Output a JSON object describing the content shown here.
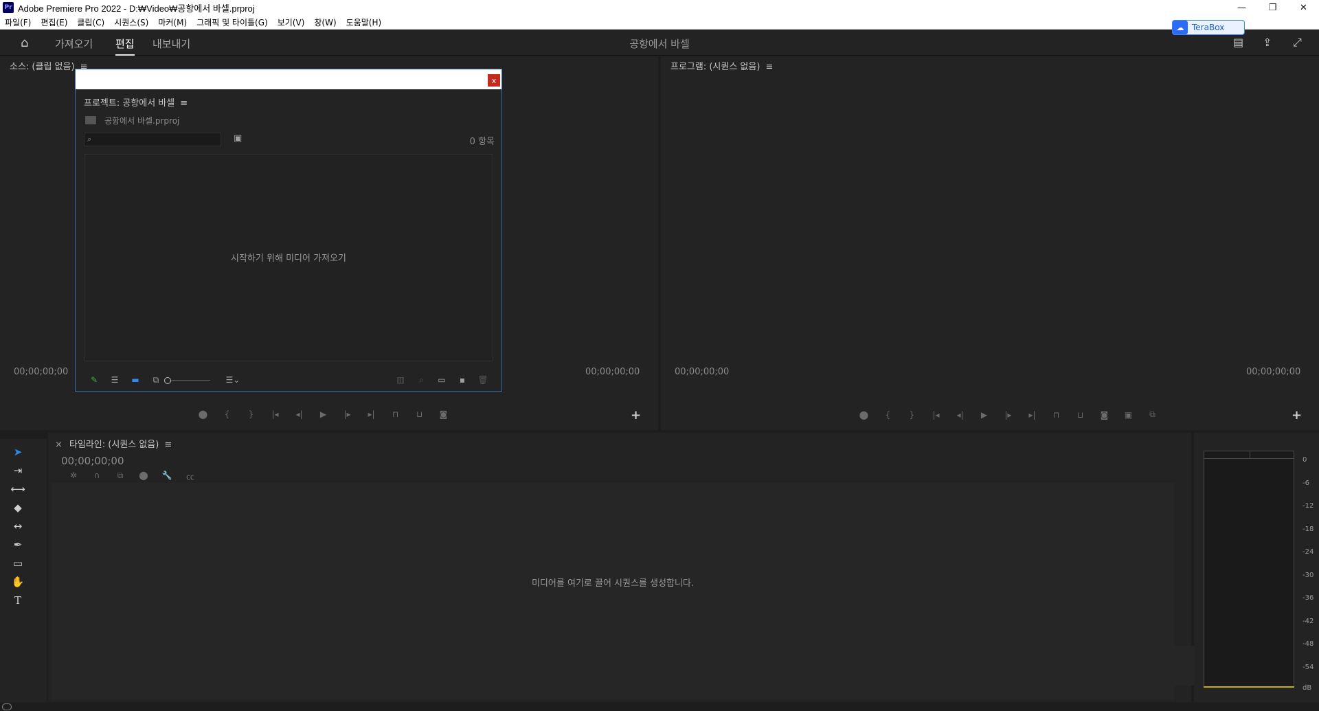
{
  "titlebar": {
    "logo": "Pr",
    "title": "Adobe Premiere Pro 2022 - D:₩Video₩공항에서 바셀.prproj",
    "minimize": "—",
    "restore": "❐",
    "close": "✕"
  },
  "menubar": {
    "items": [
      "파일(F)",
      "편집(E)",
      "클립(C)",
      "시퀀스(S)",
      "마커(M)",
      "그래픽 및 타이틀(G)",
      "보기(V)",
      "창(W)",
      "도움말(H)"
    ]
  },
  "terabox": {
    "label": "TeraBox",
    "icon": "cloud-upload-icon"
  },
  "workspace": {
    "tabs": [
      "가져오기",
      "편집",
      "내보내기"
    ],
    "active_tab": "편집",
    "project_title": "공항에서 바셀"
  },
  "source_panel": {
    "title": "소스: (클립 없음)",
    "tc_left": "00;00;00;00",
    "tc_right": "00;00;00;00"
  },
  "program_panel": {
    "title": "프로그램: (시퀀스 없음)",
    "tc_left": "00;00;00;00",
    "tc_right": "00;00;00;00"
  },
  "project_panel": {
    "close": "x",
    "title": "프로젝트: 공항에서 바셀",
    "file": "공항에서 바셀.prproj",
    "search_icon": "⌕",
    "item_count": "0 항목",
    "empty_message": "시작하기 위해 미디어 가져오기"
  },
  "timeline": {
    "title": "타임라인: (시퀀스 없음)",
    "timecode": "00;00;00;00",
    "empty_message": "미디어를 여기로 끌어 시퀀스를 생성합니다."
  },
  "audio_meter": {
    "scale": [
      "0",
      "-6",
      "-12",
      "-18",
      "-24",
      "-30",
      "-36",
      "-42",
      "-48",
      "-54",
      "dB"
    ]
  },
  "colors": {
    "accent_blue": "#2d8ceb",
    "panel_bg": "#232323",
    "meter_yellow": "#c9b000",
    "close_red": "#c42b1c"
  }
}
